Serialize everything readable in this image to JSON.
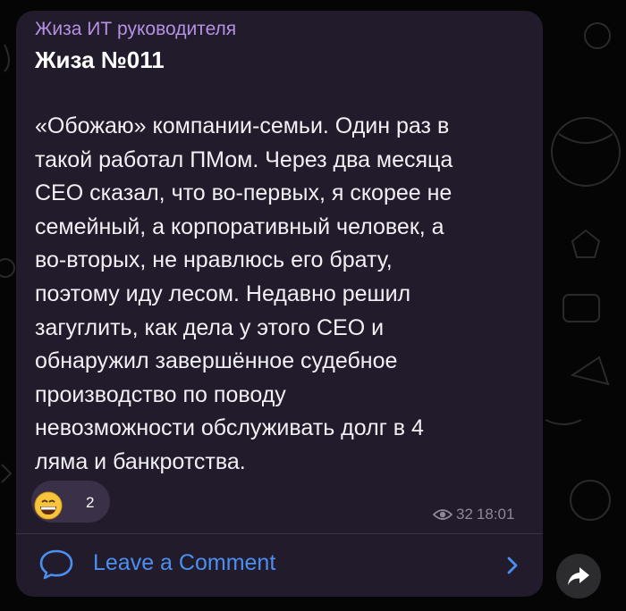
{
  "post": {
    "channel_name": "Жиза ИТ руководителя",
    "title": "Жиза №011",
    "body": "«Обожаю» компании-семьи. Один раз в\nтакой работал ПМом. Через два месяца\nСЕО сказал, что во-первых, я скорее не\nсемейный, а корпоративный человек, а\nво-вторых, не нравлюсь его брату,\nпоэтому иду лесом. Недавно решил\nзагуглить, как дела у этого СЕО и\nобнаружил завершённое судебное\nпроизводство по поводу\nневозможности обслуживать долг в 4\nляма и банкротства.",
    "reaction": {
      "emoji": "grinning-face-icon",
      "count": "2"
    },
    "views": "32",
    "time": "18:01"
  },
  "comments": {
    "label": "Leave a Comment"
  },
  "colors": {
    "background": "#050505",
    "bubble": "#221b2b",
    "channel_name": "#b491e3",
    "link": "#4b8ff0",
    "meta": "#8e8796"
  }
}
